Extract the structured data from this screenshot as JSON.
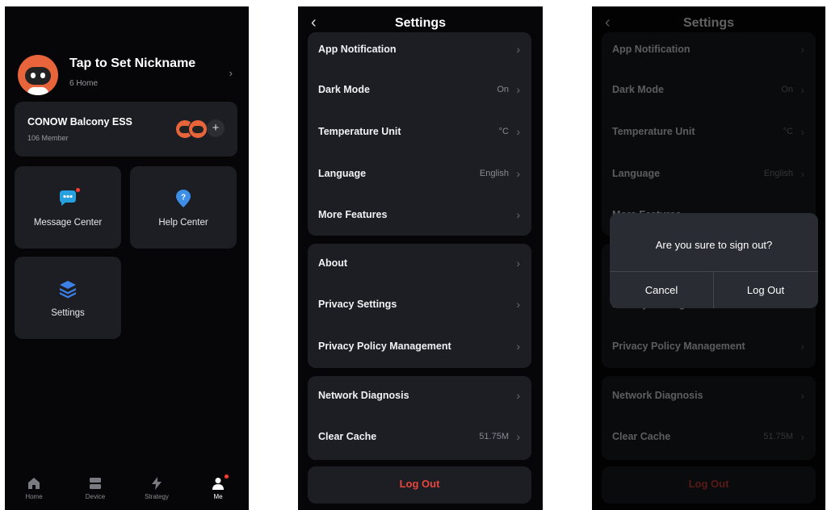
{
  "me": {
    "nickname": "Tap to Set Nickname",
    "homes": "6 Home",
    "family": {
      "name": "CONOW Balcony ESS",
      "members": "106 Member"
    },
    "tiles": {
      "message": "Message Center",
      "help": "Help Center",
      "settings": "Settings"
    },
    "tabs": {
      "home": "Home",
      "device": "Device",
      "strategy": "Strategy",
      "me": "Me"
    },
    "accent": "#e8643a"
  },
  "settings": {
    "title": "Settings",
    "app_notification": "App Notification",
    "dark_mode": "Dark Mode",
    "dark_mode_value": "On",
    "temperature_unit": "Temperature Unit",
    "temperature_unit_value": "°C",
    "language": "Language",
    "language_value": "English",
    "more_features": "More Features",
    "about": "About",
    "privacy_settings": "Privacy Settings",
    "privacy_policy": "Privacy Policy Management",
    "network_diagnosis": "Network Diagnosis",
    "clear_cache": "Clear Cache",
    "clear_cache_value": "51.75M",
    "log_out": "Log Out",
    "log_out_color": "#e8453c"
  },
  "dialog": {
    "question": "Are you sure to sign out?",
    "cancel": "Cancel",
    "confirm": "Log Out"
  }
}
